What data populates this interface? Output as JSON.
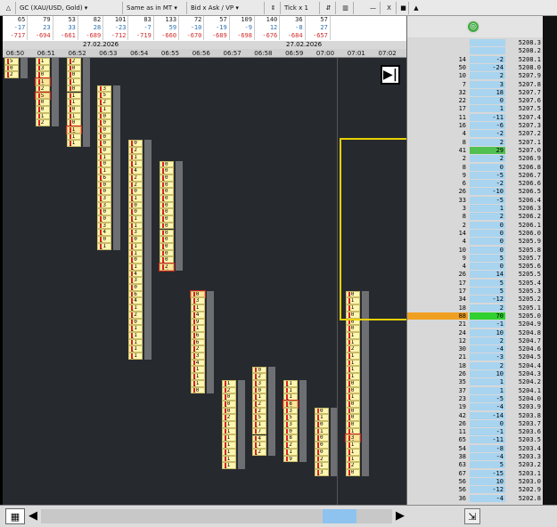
{
  "toolbar": {
    "symbol": "GC (XAU/USD, Gold)",
    "mode": "Same as in MT",
    "view": "Bid x Ask / VP",
    "tick": "Tick x 1",
    "close": "X",
    "minimize": "—"
  },
  "stats": {
    "row1": [
      "65",
      "79",
      "53",
      "82",
      "101",
      "83",
      "133",
      "72",
      "57",
      "109",
      "140",
      "36",
      "57"
    ],
    "row2": [
      "-17",
      "23",
      "33",
      "28",
      "-23",
      "-7",
      "59",
      "-10",
      "-19",
      "-9",
      "12",
      "-8",
      "27"
    ],
    "row3": [
      "-717",
      "-694",
      "-661",
      "-689",
      "-712",
      "-719",
      "-660",
      "-670",
      "-689",
      "-698",
      "-676",
      "-684",
      "-657"
    ]
  },
  "dates": {
    "left": "27.02.2026",
    "right": "27.02.2026"
  },
  "times": [
    "06:50",
    "06:51",
    "06:52",
    "06:53",
    "06:54",
    "06:55",
    "06:56",
    "06:57",
    "06:58",
    "06:59",
    "07:00",
    "07:01",
    "07:02"
  ],
  "ladder": {
    "rows": [
      {
        "v1": "",
        "v2": "",
        "price": "5208.3"
      },
      {
        "v1": "",
        "v2": "",
        "price": "5208.2"
      },
      {
        "v1": "14",
        "v2": "-2",
        "price": "5208.1"
      },
      {
        "v1": "50",
        "v2": "-24",
        "price": "5208.0"
      },
      {
        "v1": "10",
        "v2": "2",
        "price": "5207.9"
      },
      {
        "v1": "7",
        "v2": "3",
        "price": "5207.8"
      },
      {
        "v1": "32",
        "v2": "18",
        "price": "5207.7"
      },
      {
        "v1": "22",
        "v2": "0",
        "price": "5207.6"
      },
      {
        "v1": "17",
        "v2": "1",
        "price": "5207.5"
      },
      {
        "v1": "11",
        "v2": "-11",
        "price": "5207.4"
      },
      {
        "v1": "16",
        "v2": "-6",
        "price": "5207.3"
      },
      {
        "v1": "4",
        "v2": "-2",
        "price": "5207.2"
      },
      {
        "v1": "8",
        "v2": "2",
        "price": "5207.1"
      },
      {
        "v1": "41",
        "v2": "29",
        "price": "5207.0"
      },
      {
        "v1": "2",
        "v2": "2",
        "price": "5206.9"
      },
      {
        "v1": "8",
        "v2": "0",
        "price": "5206.8"
      },
      {
        "v1": "9",
        "v2": "-5",
        "price": "5206.7"
      },
      {
        "v1": "6",
        "v2": "-2",
        "price": "5206.6"
      },
      {
        "v1": "26",
        "v2": "-10",
        "price": "5206.5"
      },
      {
        "v1": "33",
        "v2": "-5",
        "price": "5206.4"
      },
      {
        "v1": "3",
        "v2": "1",
        "price": "5206.3"
      },
      {
        "v1": "8",
        "v2": "2",
        "price": "5206.2"
      },
      {
        "v1": "2",
        "v2": "0",
        "price": "5206.1"
      },
      {
        "v1": "14",
        "v2": "0",
        "price": "5206.0"
      },
      {
        "v1": "4",
        "v2": "0",
        "price": "5205.9"
      },
      {
        "v1": "10",
        "v2": "0",
        "price": "5205.8"
      },
      {
        "v1": "9",
        "v2": "5",
        "price": "5205.7"
      },
      {
        "v1": "4",
        "v2": "0",
        "price": "5205.6"
      },
      {
        "v1": "26",
        "v2": "14",
        "price": "5205.5"
      },
      {
        "v1": "17",
        "v2": "5",
        "price": "5205.4"
      },
      {
        "v1": "17",
        "v2": "5",
        "price": "5205.3"
      },
      {
        "v1": "34",
        "v2": "-12",
        "price": "5205.2"
      },
      {
        "v1": "18",
        "v2": "2",
        "price": "5205.1"
      },
      {
        "v1": "88",
        "v2": "70",
        "price": "5205.0"
      },
      {
        "v1": "21",
        "v2": "-1",
        "price": "5204.9"
      },
      {
        "v1": "24",
        "v2": "10",
        "price": "5204.8"
      },
      {
        "v1": "12",
        "v2": "2",
        "price": "5204.7"
      },
      {
        "v1": "30",
        "v2": "-4",
        "price": "5204.6"
      },
      {
        "v1": "21",
        "v2": "-3",
        "price": "5204.5"
      },
      {
        "v1": "18",
        "v2": "2",
        "price": "5204.4"
      },
      {
        "v1": "26",
        "v2": "10",
        "price": "5204.3"
      },
      {
        "v1": "35",
        "v2": "1",
        "price": "5204.2"
      },
      {
        "v1": "37",
        "v2": "1",
        "price": "5204.1"
      },
      {
        "v1": "23",
        "v2": "-5",
        "price": "5204.0"
      },
      {
        "v1": "19",
        "v2": "-4",
        "price": "5203.9"
      },
      {
        "v1": "42",
        "v2": "-14",
        "price": "5203.8"
      },
      {
        "v1": "26",
        "v2": "0",
        "price": "5203.7"
      },
      {
        "v1": "11",
        "v2": "-1",
        "price": "5203.6"
      },
      {
        "v1": "65",
        "v2": "-11",
        "price": "5203.5"
      },
      {
        "v1": "54",
        "v2": "-8",
        "price": "5203.4"
      },
      {
        "v1": "38",
        "v2": "-4",
        "price": "5203.3"
      },
      {
        "v1": "63",
        "v2": "5",
        "price": "5203.2"
      },
      {
        "v1": "67",
        "v2": "-15",
        "price": "5203.1"
      },
      {
        "v1": "56",
        "v2": "10",
        "price": "5203.0"
      },
      {
        "v1": "56",
        "v2": "-12",
        "price": "5202.9"
      },
      {
        "v1": "36",
        "v2": "-4",
        "price": "5202.8"
      }
    ]
  },
  "footprint": [
    {
      "col": 0,
      "start": 0,
      "cells": [
        "5 0",
        "0 1",
        "2 0"
      ]
    },
    {
      "col": 1,
      "start": 0,
      "cells": [
        "1 0",
        "3 1",
        "0 0",
        "1 22",
        "2 5",
        "5 11",
        "0 2",
        "0 3",
        "1 0",
        "2 0"
      ]
    },
    {
      "col": 2,
      "start": 0,
      "cells": [
        "2 3",
        "0 1",
        "0 1",
        "1 0",
        "0 1",
        "1 1",
        "1 0",
        "0 1",
        "1 0",
        "0 0",
        "1 27",
        "1 0",
        "1 0"
      ]
    },
    {
      "col": 3,
      "start": 4,
      "cells": [
        "3 2",
        "5 0",
        "2 0",
        "1 0",
        "0 0",
        "0 1",
        "0 1",
        "0 0",
        "0 0",
        "0 1",
        "1 0",
        "0 0",
        "1 0",
        "6 1",
        "0 1",
        "0 0",
        "3 0",
        "3 0",
        "0 2",
        "0 0",
        "3 0",
        "4 0",
        "0 2",
        "1 0"
      ]
    },
    {
      "col": 4,
      "start": 12,
      "cells": [
        "0 2",
        "2 1",
        "1 0",
        "1 2",
        "4 0",
        "2 1",
        "2 0",
        "0 1",
        "1 0",
        "0 0",
        "0 0",
        "1 0",
        "1 0",
        "3 0",
        "0 1",
        "1 0",
        "1 0",
        "0 0",
        "1 5",
        "4 4",
        "3 1",
        "0 1",
        "6 5",
        "4 3",
        "1 3",
        "2 0",
        "0 1",
        "1 3",
        "1 2",
        "1 0",
        "1 0",
        "1 0"
      ]
    },
    {
      "col": 5,
      "start": 15,
      "cells": [
        "0 0",
        "0 0",
        "0 0",
        "0 1",
        "0 0",
        "0 0",
        "0 1",
        "0 0",
        "0 0",
        "0 1",
        "0 0",
        "0 0",
        "0 0",
        "0 0",
        "0 0",
        "2 14"
      ]
    },
    {
      "col": 6,
      "start": 34,
      "cells": [
        "0 63",
        "3 4",
        "1 6",
        "4 2",
        "9 2",
        "1 0",
        "6 4",
        "6 3",
        "2 3",
        "3 0",
        "4 1",
        "1 0",
        "1 0",
        "1 0",
        "0 0"
      ]
    },
    {
      "col": 7,
      "start": 47,
      "cells": [
        "1 1",
        "2 1",
        "0 2",
        "0 0",
        "0 2",
        "2 2",
        "1 0",
        "1 1",
        "1 0",
        "1 1",
        "1 0",
        "1 0",
        "1 2"
      ]
    },
    {
      "col": 8,
      "start": 45,
      "cells": [
        "0 1",
        "2 0",
        "3 0",
        "0 0",
        "1 2",
        "2 0",
        "2 0",
        "5 3",
        "1 0",
        "7 4",
        "4 3",
        "1 2",
        "2 1"
      ]
    },
    {
      "col": 9,
      "start": 47,
      "cells": [
        "1 2",
        "1 0",
        "1 0",
        "8 10",
        "3 0",
        "5 6",
        "3 2",
        "0 0",
        "8 8",
        "2 7",
        "1 6",
        "9 0"
      ]
    },
    {
      "col": 10,
      "start": 51,
      "cells": [
        "0 1",
        "1 0",
        "0 1",
        "1 0",
        "0 1",
        "0 1",
        "0 0",
        "2 1",
        "1 0",
        "3 2"
      ]
    },
    {
      "col": 11,
      "start": 34,
      "cells": [
        "0 8",
        "1 0",
        "1 0",
        "0 0",
        "0 0",
        "0 0",
        "1 0",
        "1 0",
        "2 0",
        "1 0",
        "1 0",
        "1 0",
        "1 2",
        "0 2",
        "0 0",
        "1 0",
        "0 0",
        "0 0",
        "0 0",
        "0 1",
        "1 0",
        "3 11",
        "1 0",
        "1 0",
        "1 0",
        "2 1",
        "0 1"
      ]
    }
  ]
}
